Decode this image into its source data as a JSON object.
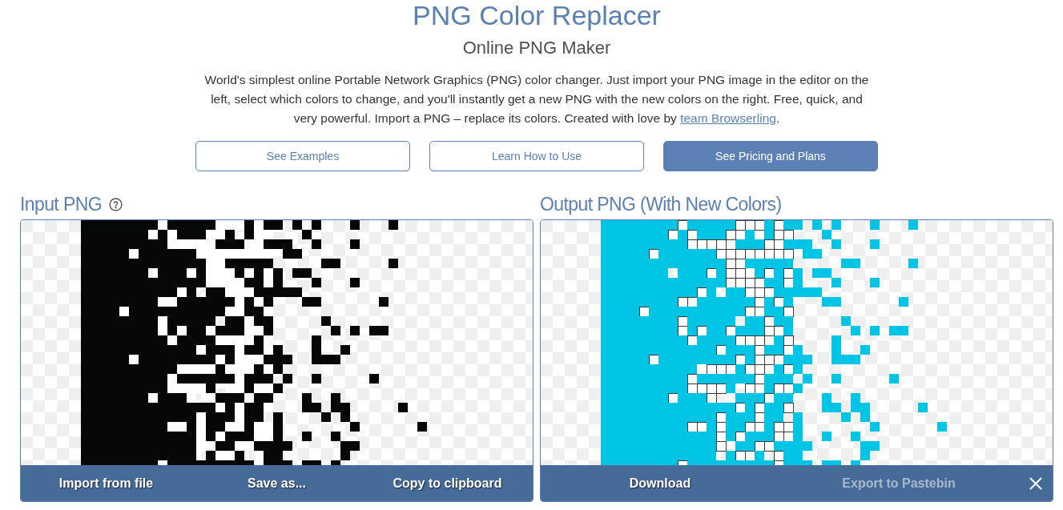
{
  "header": {
    "title": "PNG Color Replacer",
    "subtitle": "Online PNG Maker",
    "description": "World's simplest online Portable Network Graphics (PNG) color changer. Just import your PNG image in the editor on the left, select which colors to change, and you'll instantly get a new PNG with the new colors on the right. Free, quick, and very powerful. Import a PNG – replace its colors. Created with love by ",
    "link": "team Browserling",
    "description_end": "."
  },
  "buttons": [
    {
      "label": "See Examples",
      "kind": "outline"
    },
    {
      "label": "Learn How to Use",
      "kind": "outline"
    },
    {
      "label": "See Pricing and Plans",
      "kind": "primary"
    }
  ],
  "panels": [
    {
      "kind": "input",
      "title": "Input PNG",
      "actions": [
        {
          "label": "Import from file",
          "disabled": false
        },
        {
          "label": "Save as...",
          "disabled": false
        },
        {
          "label": "Copy to clipboard",
          "disabled": false
        }
      ]
    },
    {
      "kind": "output",
      "title": "Output PNG (With New Colors)",
      "actions": [
        {
          "label": "Download",
          "disabled": false
        },
        {
          "label": "Export to Pastebin",
          "disabled": true
        }
      ]
    }
  ]
}
